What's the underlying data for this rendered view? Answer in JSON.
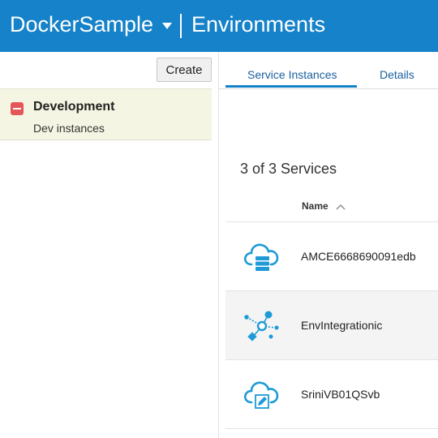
{
  "header": {
    "app_name": "DockerSample",
    "page_title": "Environments"
  },
  "left": {
    "create_label": "Create",
    "environments": [
      {
        "name": "Development",
        "description": "Dev instances"
      }
    ]
  },
  "right": {
    "tabs": [
      {
        "label": "Service Instances",
        "selected": true
      },
      {
        "label": "Details",
        "selected": false
      }
    ],
    "count_text": "3 of 3 Services",
    "column_name": "Name",
    "rows": [
      {
        "name": "AMCE6668690091edb",
        "icon": "cloud-database-icon"
      },
      {
        "name": "EnvIntegrationic",
        "icon": "integration-network-icon"
      },
      {
        "name": "SriniVB01QSvb",
        "icon": "cloud-edit-icon"
      }
    ]
  },
  "colors": {
    "header": "#1582c9",
    "accent": "#1e9bd7",
    "badge": "#e5565a"
  }
}
